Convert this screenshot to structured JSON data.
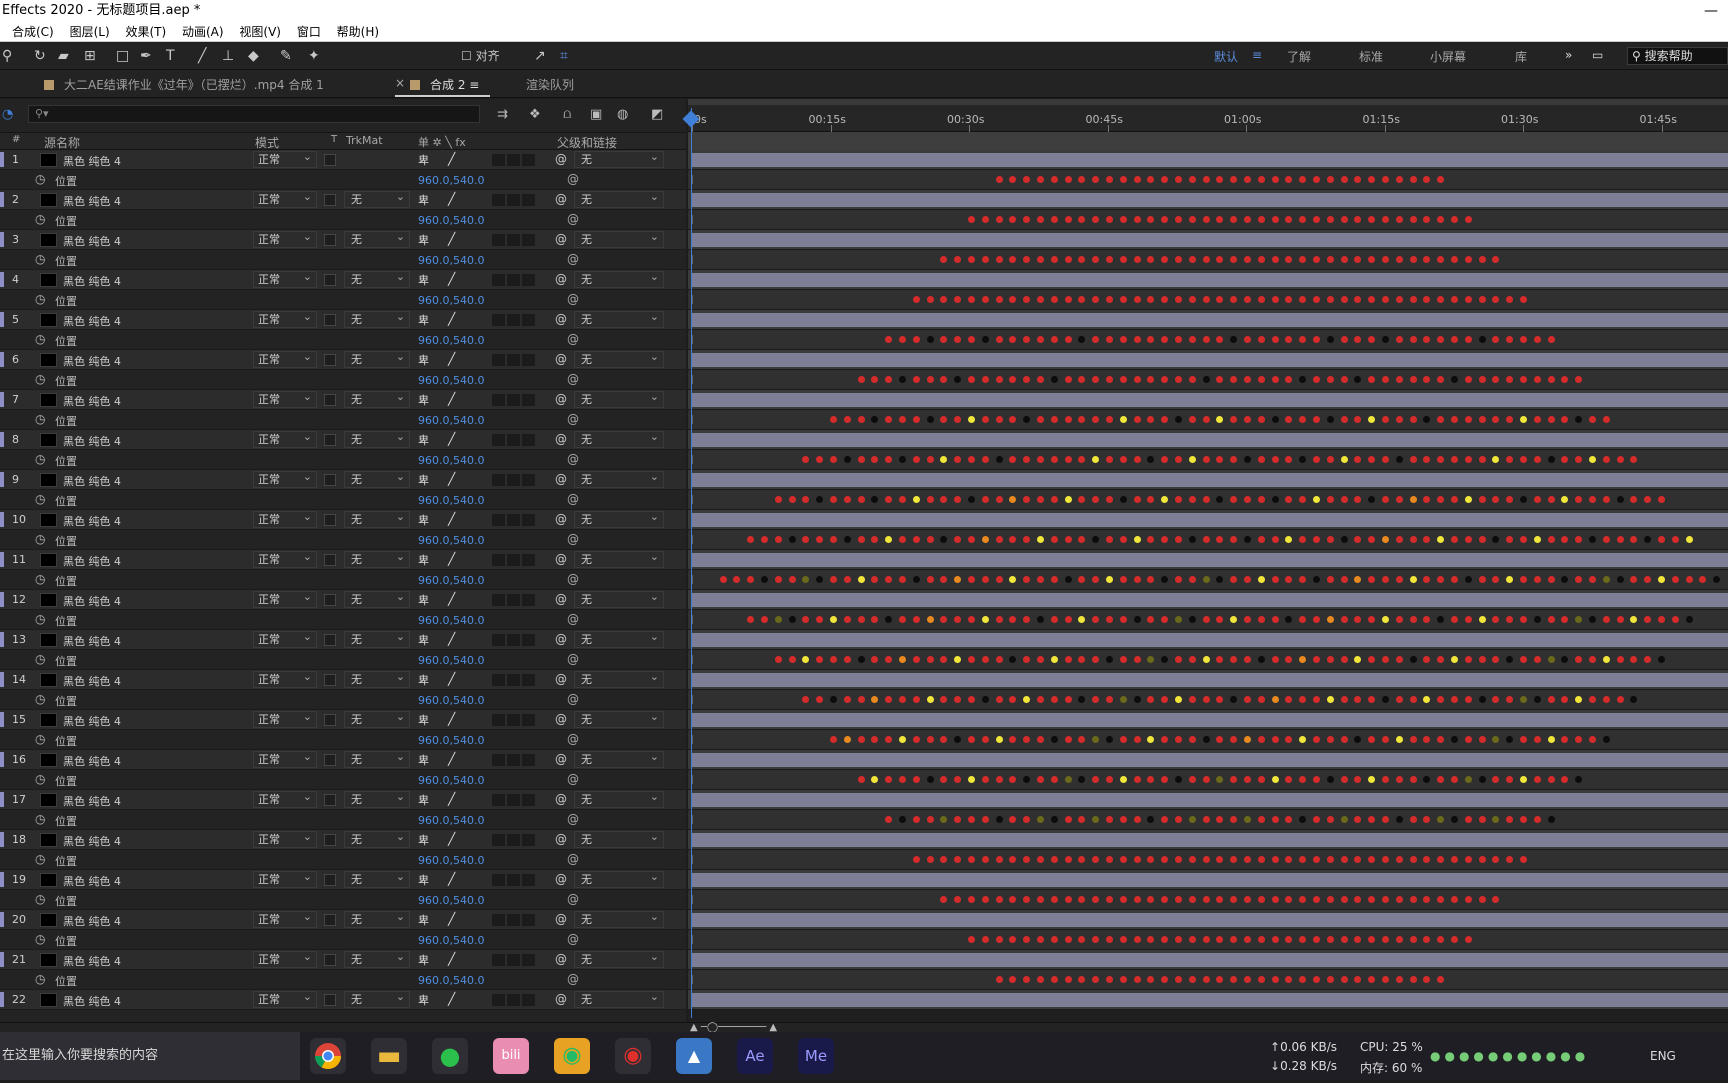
{
  "window": {
    "title": "Effects 2020 - 无标题项目.aep *"
  },
  "menu": [
    "合成(C)",
    "图层(L)",
    "效果(T)",
    "动画(A)",
    "视图(V)",
    "窗口",
    "帮助(H)"
  ],
  "toolbar": {
    "align_label": "对齐",
    "workspaces": [
      "默认",
      "了解",
      "标准",
      "小屏幕",
      "库"
    ],
    "active_workspace": "默认",
    "help_placeholder": "搜索帮助"
  },
  "tabs": [
    {
      "label": "大二AE结课作业《过年》（已摆烂）.mp4 合成 1",
      "active": false
    },
    {
      "label": "合成 2",
      "active": true
    },
    {
      "label": "渲染队列",
      "active": false
    }
  ],
  "columns": {
    "num": "#",
    "source": "源名称",
    "mode": "模式",
    "t": "T",
    "trkmat": "TrkMat",
    "switches": "单 ✲ ╲ fx",
    "parent": "父级和链接"
  },
  "layer_name": "黑色 纯色 4",
  "mode_value": "正常",
  "trkmat_value": "无",
  "parent_value": "无",
  "property_name": "位置",
  "property_value": "960.0,540.0",
  "layers": [
    1,
    2,
    3,
    4,
    5,
    6,
    7,
    8,
    9,
    10,
    11,
    12,
    13,
    14,
    15,
    16,
    17,
    18,
    19,
    20,
    21,
    22
  ],
  "ruler": [
    "0s",
    "00:15s",
    "00:30s",
    "00:45s",
    "01:00s",
    "01:15s",
    "01:30s",
    "01:45s"
  ],
  "colors": {
    "keyframe": "#d62b2b",
    "yellow": "#f2e63b",
    "orange": "#e88a1f",
    "olive": "#6b6a1a",
    "black": "#0c0c0c",
    "label": "#8e8fc6",
    "playhead": "#3f7fd8"
  },
  "taskbar": {
    "search_placeholder": "在这里输入你要搜索的内容",
    "net_up": "0.06 KB/s",
    "net_down": "0.28 KB/s",
    "cpu": "CPU: 25 %",
    "mem": "内存: 60 %",
    "lang": "ENG",
    "apps": [
      "Ae",
      "Me"
    ]
  }
}
